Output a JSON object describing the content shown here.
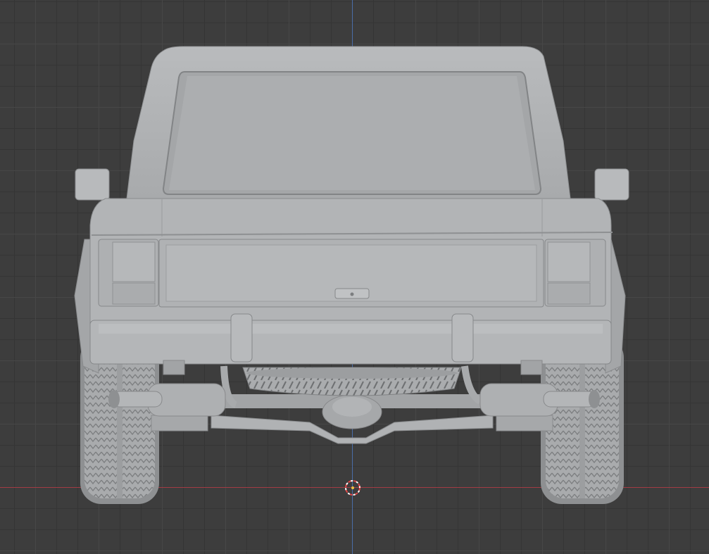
{
  "viewport": {
    "view": "back-orthographic",
    "grid": true,
    "colors": {
      "background": "#3d3d3d",
      "grid_major": "#474747",
      "grid_minor": "#353535",
      "x_axis": "#a33b44",
      "z_axis": "#4a6da8",
      "model": "#b4b6b8",
      "cursor_red": "#e14646"
    }
  },
  "model": {
    "name": "pickup-truck-rear",
    "parts": [
      "roof",
      "rear-window",
      "side-mirror-left",
      "side-mirror-right",
      "taillight-left",
      "taillight-right",
      "tailgate",
      "license-plate-light",
      "bumper",
      "wheel-left",
      "wheel-right",
      "exhaust-left",
      "exhaust-right",
      "spare-tire",
      "differential"
    ]
  },
  "cursor": {
    "icon": "3d-cursor-icon"
  }
}
